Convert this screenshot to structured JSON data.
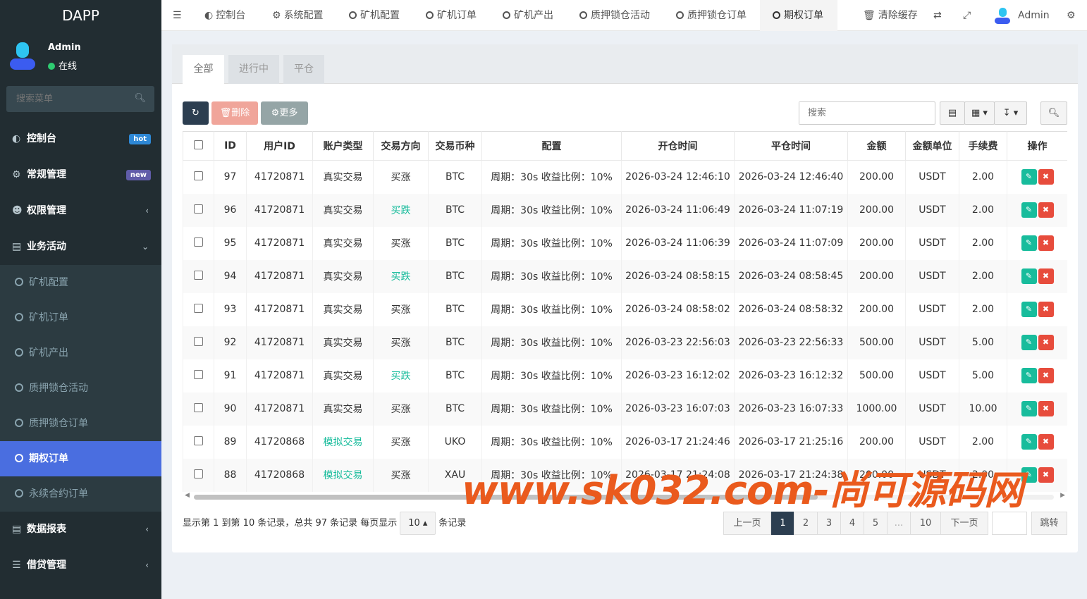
{
  "app": {
    "logo": "DAPP"
  },
  "user": {
    "name": "Admin",
    "status": "在线"
  },
  "side_search": {
    "placeholder": "搜索菜单"
  },
  "menu": {
    "dashboard": {
      "label": "控制台",
      "badge": "hot",
      "badge_color": "#2e88d6"
    },
    "general": {
      "label": "常规管理",
      "badge": "new",
      "badge_color": "#605ca8"
    },
    "permission": {
      "label": "权限管理"
    },
    "business": {
      "label": "业务活动"
    },
    "business_items": [
      "矿机配置",
      "矿机订单",
      "矿机产出",
      "质押锁仓活动",
      "质押锁仓订单",
      "期权订单",
      "永续合约订单"
    ],
    "reports": {
      "label": "数据报表"
    },
    "loans": {
      "label": "借贷管理"
    }
  },
  "topbar": {
    "tabs": [
      "控制台",
      "系统配置",
      "矿机配置",
      "矿机订单",
      "矿机产出",
      "质押锁仓活动",
      "质押锁仓订单",
      "期权订单"
    ],
    "clear_cache": "清除缓存",
    "admin": "Admin"
  },
  "page_tabs": [
    "全部",
    "进行中",
    "平仓"
  ],
  "toolbar": {
    "delete": "删除",
    "more": "更多",
    "search_placeholder": "搜索"
  },
  "table": {
    "headers": [
      "ID",
      "用户ID",
      "账户类型",
      "交易方向",
      "交易币种",
      "配置",
      "开仓时间",
      "平仓时间",
      "金额",
      "金额单位",
      "手续费",
      "操作"
    ],
    "rows": [
      {
        "id": "97",
        "uid": "41720871",
        "acct": "真实交易",
        "dir": "买涨",
        "coin": "BTC",
        "cfg": "周期：30s 收益比例：10%",
        "open": "2026-03-24 12:46:10",
        "close": "2026-03-24 12:46:40",
        "amt": "200.00",
        "unit": "USDT",
        "fee": "2.00"
      },
      {
        "id": "96",
        "uid": "41720871",
        "acct": "真实交易",
        "dir": "买跌",
        "coin": "BTC",
        "cfg": "周期：30s 收益比例：10%",
        "open": "2026-03-24 11:06:49",
        "close": "2026-03-24 11:07:19",
        "amt": "200.00",
        "unit": "USDT",
        "fee": "2.00"
      },
      {
        "id": "95",
        "uid": "41720871",
        "acct": "真实交易",
        "dir": "买涨",
        "coin": "BTC",
        "cfg": "周期：30s 收益比例：10%",
        "open": "2026-03-24 11:06:39",
        "close": "2026-03-24 11:07:09",
        "amt": "200.00",
        "unit": "USDT",
        "fee": "2.00"
      },
      {
        "id": "94",
        "uid": "41720871",
        "acct": "真实交易",
        "dir": "买跌",
        "coin": "BTC",
        "cfg": "周期：30s 收益比例：10%",
        "open": "2026-03-24 08:58:15",
        "close": "2026-03-24 08:58:45",
        "amt": "200.00",
        "unit": "USDT",
        "fee": "2.00"
      },
      {
        "id": "93",
        "uid": "41720871",
        "acct": "真实交易",
        "dir": "买涨",
        "coin": "BTC",
        "cfg": "周期：30s 收益比例：10%",
        "open": "2026-03-24 08:58:02",
        "close": "2026-03-24 08:58:32",
        "amt": "200.00",
        "unit": "USDT",
        "fee": "2.00"
      },
      {
        "id": "92",
        "uid": "41720871",
        "acct": "真实交易",
        "dir": "买涨",
        "coin": "BTC",
        "cfg": "周期：30s 收益比例：10%",
        "open": "2026-03-23 22:56:03",
        "close": "2026-03-23 22:56:33",
        "amt": "500.00",
        "unit": "USDT",
        "fee": "5.00"
      },
      {
        "id": "91",
        "uid": "41720871",
        "acct": "真实交易",
        "dir": "买跌",
        "coin": "BTC",
        "cfg": "周期：30s 收益比例：10%",
        "open": "2026-03-23 16:12:02",
        "close": "2026-03-23 16:12:32",
        "amt": "500.00",
        "unit": "USDT",
        "fee": "5.00"
      },
      {
        "id": "90",
        "uid": "41720871",
        "acct": "真实交易",
        "dir": "买涨",
        "coin": "BTC",
        "cfg": "周期：30s 收益比例：10%",
        "open": "2026-03-23 16:07:03",
        "close": "2026-03-23 16:07:33",
        "amt": "1000.00",
        "unit": "USDT",
        "fee": "10.00"
      },
      {
        "id": "89",
        "uid": "41720868",
        "acct": "模拟交易",
        "dir": "买涨",
        "coin": "UKO",
        "cfg": "周期：30s 收益比例：10%",
        "open": "2026-03-17 21:24:46",
        "close": "2026-03-17 21:25:16",
        "amt": "200.00",
        "unit": "USDT",
        "fee": "2.00"
      },
      {
        "id": "88",
        "uid": "41720868",
        "acct": "模拟交易",
        "dir": "买涨",
        "coin": "XAU",
        "cfg": "周期：30s 收益比例：10%",
        "open": "2026-03-17 21:24:08",
        "close": "2026-03-17 21:24:38",
        "amt": "200.00",
        "unit": "USDT",
        "fee": "2.00"
      }
    ]
  },
  "pagination": {
    "info_prefix": "显示第 1 到第 10 条记录，总共 97 条记录 每页显示",
    "page_size": "10",
    "info_suffix": "条记录",
    "prev": "上一页",
    "pages": [
      "1",
      "2",
      "3",
      "4",
      "5",
      "...",
      "10"
    ],
    "next": "下一页",
    "jump": "跳转"
  },
  "watermark": "www.sk032.com-尚可源码网",
  "colors": {
    "sidebar": "#222d32",
    "active": "#4a6ee0",
    "accent_green": "#18bc9c",
    "danger": "#e74c3c",
    "watermark": "#ea5a1d"
  }
}
